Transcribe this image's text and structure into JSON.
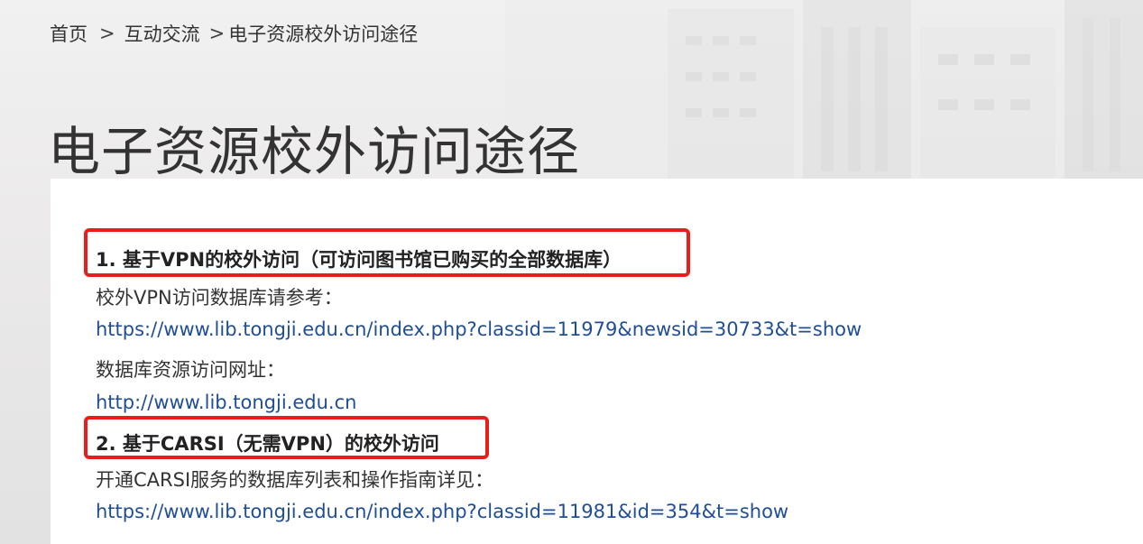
{
  "breadcrumb": {
    "home": "首页",
    "section": "互动交流",
    "current": "电子资源校外访问途径",
    "separator": ">"
  },
  "page": {
    "title": "电子资源校外访问途径"
  },
  "content": {
    "heading1": "1. 基于VPN的校外访问（可访问图书馆已购买的全部数据库）",
    "vpn_ref_label": "校外VPN访问数据库请参考：",
    "vpn_ref_link": "https://www.lib.tongji.edu.cn/index.php?classid=11979&newsid=30733&t=show",
    "db_address_label": "数据库资源访问网址：",
    "db_address_link": "http://www.lib.tongji.edu.cn",
    "heading2": "2. 基于CARSI（无需VPN）的校外访问",
    "carsi_label": "开通CARSI服务的数据库列表和操作指南详见：",
    "carsi_link": "https://www.lib.tongji.edu.cn/index.php?classid=11981&id=354&t=show"
  },
  "colors": {
    "link": "#1f4e96",
    "highlight": "#ea1d1d",
    "text": "#333333"
  }
}
